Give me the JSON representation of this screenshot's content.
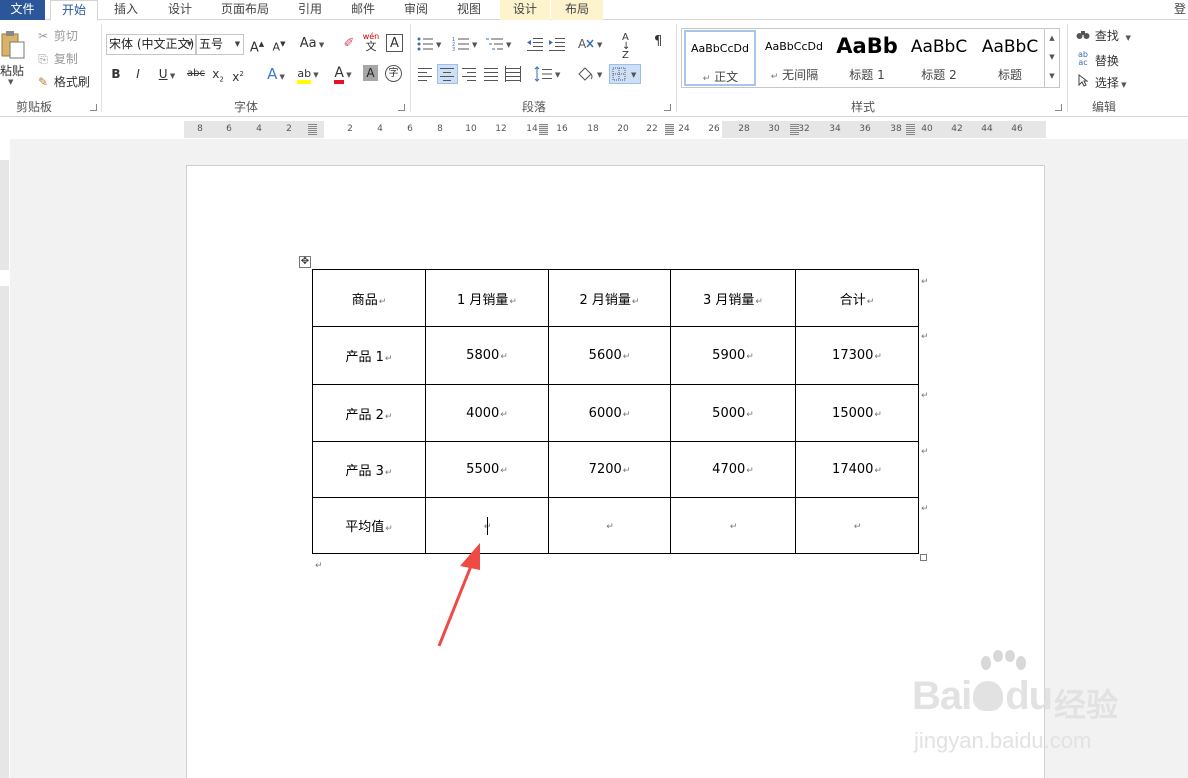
{
  "tabs": {
    "file": "文件",
    "home": "开始",
    "insert": "插入",
    "design": "设计",
    "page_layout": "页面布局",
    "references": "引用",
    "mailings": "邮件",
    "review": "审阅",
    "view": "视图",
    "table_design": "设计",
    "table_layout": "布局",
    "login": "登"
  },
  "clipboard": {
    "paste": "粘贴",
    "cut": "剪切",
    "copy": "复制",
    "format_painter": "格式刷",
    "label": "剪贴板"
  },
  "font": {
    "name": "宋体 (中文正文)",
    "size": "五号",
    "grow": "A",
    "shrink": "A",
    "change_case": "Aa",
    "pinyin_top": "wén",
    "pinyin_bottom": "文",
    "border_char": "A",
    "bold": "B",
    "italic": "I",
    "underline": "U",
    "strikethrough": "abc",
    "subscript": "x",
    "subscript_mark": "2",
    "superscript": "x",
    "superscript_mark": "2",
    "text_effects": "A",
    "font_color": "A",
    "char_shading": "A",
    "enclose_char": "字",
    "label": "字体",
    "highlight_color": "#ffff00",
    "font_color_value": "#e81123"
  },
  "paragraph": {
    "label": "段落",
    "sort": "A↓Z",
    "show_marks": "¶"
  },
  "styles": {
    "label": "样式",
    "items": [
      {
        "sample": "AaBbCcDd",
        "name": "正文",
        "mark": "↵"
      },
      {
        "sample": "AaBbCcDd",
        "name": "无间隔",
        "mark": "↵"
      },
      {
        "sample": "AaBb",
        "name": "标题 1"
      },
      {
        "sample": "AaBbC",
        "name": "标题 2"
      },
      {
        "sample": "AaBbC",
        "name": "标题"
      }
    ]
  },
  "editing": {
    "find": "查找",
    "replace": "替换",
    "select": "选择",
    "label": "编辑"
  },
  "ruler": {
    "h_numbers": [
      "8",
      "6",
      "4",
      "2",
      "2",
      "4",
      "6",
      "8",
      "10",
      "12",
      "14",
      "16",
      "18",
      "20",
      "22",
      "24",
      "26",
      "28",
      "30",
      "32",
      "34",
      "36",
      "38",
      "40",
      "42",
      "44",
      "46"
    ]
  },
  "table": {
    "header": [
      "商品",
      "1 月销量",
      "2 月销量",
      "3 月销量",
      "合计"
    ],
    "rows": [
      [
        "产品 1",
        "5800",
        "5600",
        "5900",
        "17300"
      ],
      [
        "产品 2",
        "4000",
        "6000",
        "5000",
        "15000"
      ],
      [
        "产品 3",
        "5500",
        "7200",
        "4700",
        "17400"
      ],
      [
        "平均值",
        "",
        "",
        "",
        ""
      ]
    ]
  },
  "marks": {
    "para": "↵"
  },
  "watermark": {
    "brand": "Bai",
    "brand2": "du",
    "brand_cn": "经验",
    "url": "jingyan.baidu.com"
  },
  "colors": {
    "file_tab": "#2b579a",
    "accent": "#2b579a",
    "context_tab": "#fdf3cd",
    "arrow": "#f04a45"
  }
}
